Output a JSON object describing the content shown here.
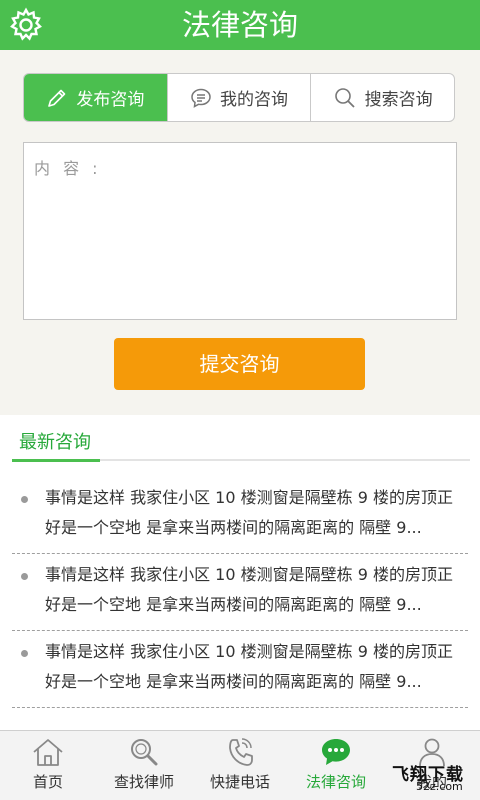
{
  "header": {
    "title": "法律咨询",
    "settings_icon": "gear-icon"
  },
  "tabs": [
    {
      "label": "发布咨询",
      "icon": "pencil-icon",
      "active": true
    },
    {
      "label": "我的咨询",
      "icon": "chat-bubble-icon",
      "active": false
    },
    {
      "label": "搜索咨询",
      "icon": "search-icon",
      "active": false
    }
  ],
  "form": {
    "content_placeholder": "内 容 :",
    "submit_label": "提交咨询"
  },
  "latest": {
    "title": "最新咨询",
    "items": [
      {
        "text": "事情是这样 我家住小区 10 楼测窗是隔壁栋 9 楼的房顶正好是一个空地 是拿来当两楼间的隔离距离的 隔壁 9..."
      },
      {
        "text": "事情是这样 我家住小区 10 楼测窗是隔壁栋 9 楼的房顶正好是一个空地 是拿来当两楼间的隔离距离的 隔壁 9..."
      },
      {
        "text": "事情是这样 我家住小区 10 楼测窗是隔壁栋 9 楼的房顶正好是一个空地 是拿来当两楼间的隔离距离的 隔壁 9..."
      }
    ]
  },
  "bottom_nav": [
    {
      "label": "首页",
      "icon": "home-icon",
      "active": false
    },
    {
      "label": "查找律师",
      "icon": "magnifier-icon",
      "active": false
    },
    {
      "label": "快捷电话",
      "icon": "phone-icon",
      "active": false
    },
    {
      "label": "法律咨询",
      "icon": "chat-icon",
      "active": true
    },
    {
      "label": "我的",
      "icon": "user-icon",
      "active": false
    }
  ],
  "watermark": {
    "text": "飞翔下载",
    "sub": "52z.com"
  },
  "colors": {
    "brand_green": "#4bbf4f",
    "accent_orange": "#f59a09",
    "link_green": "#27a83a"
  }
}
